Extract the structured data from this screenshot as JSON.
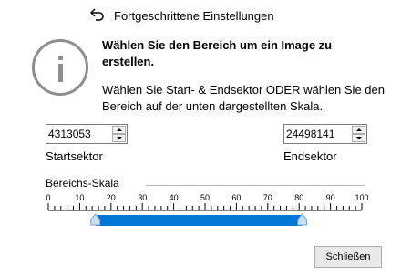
{
  "window": {
    "title": "Fortgeschrittene Einstellungen"
  },
  "info": {
    "heading": "Wählen Sie den Bereich um ein Image zu erstellen.",
    "description": "Wählen Sie Start- & Endsektor ODER wählen Sie den Bereich auf der unten dargestellten Skala."
  },
  "start": {
    "value": "4313053",
    "label": "Startsektor"
  },
  "end": {
    "value": "24498141",
    "label": "Endsektor"
  },
  "range_scale": {
    "label": "Bereichs-Skala",
    "ticks": [
      "0",
      "10",
      "20",
      "30",
      "40",
      "50",
      "60",
      "70",
      "80",
      "90",
      "100"
    ],
    "min": 0,
    "max": 100,
    "selection_start": 15,
    "selection_end": 81,
    "selection_color": "#0078d7"
  },
  "buttons": {
    "close": "Schließen"
  },
  "colors": {
    "icon_gray": "#8e8e8e",
    "accent": "#0078d7"
  }
}
